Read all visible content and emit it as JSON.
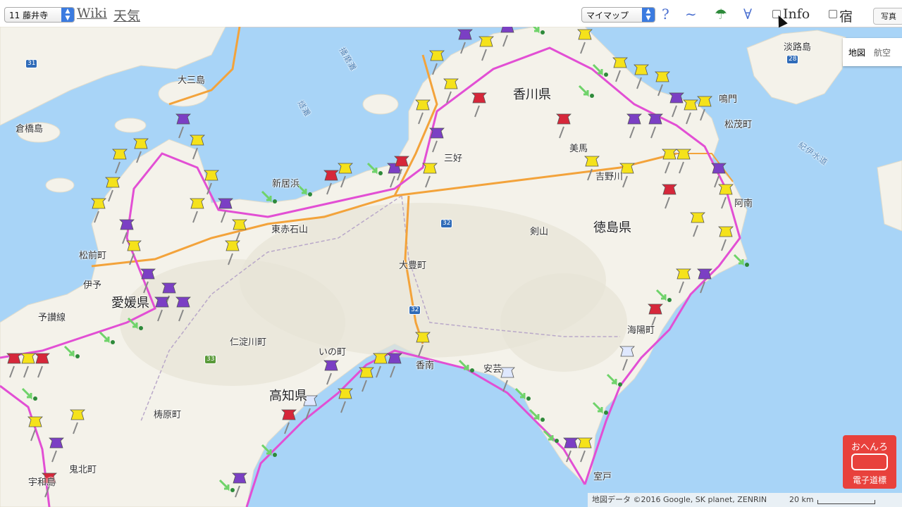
{
  "toolbar": {
    "temple_select": "11 藤井寺",
    "wiki_link": "Wiki",
    "weather_link": "天気",
    "mymap_select": "マイマップ",
    "help_glyph": "?",
    "elevation_glyph": "∼",
    "umbrella_glyph": "☂",
    "filter_glyph": "∀",
    "info_label": "Info",
    "lodging_label": "宿",
    "photo_button": "写真"
  },
  "map": {
    "type_control": {
      "map": "地図",
      "satellite": "航空"
    },
    "attribution": "地図データ ©2016 Google, SK planet, ZENRIN",
    "scale": "20 km",
    "places": [
      {
        "name": "大三島",
        "kind": "place"
      },
      {
        "name": "倉橋島",
        "kind": "place"
      },
      {
        "name": "香川県",
        "kind": "pref"
      },
      {
        "name": "徳島県",
        "kind": "pref"
      },
      {
        "name": "愛媛県",
        "kind": "pref"
      },
      {
        "name": "鳴門",
        "kind": "place"
      },
      {
        "name": "松茂町",
        "kind": "place"
      },
      {
        "name": "淡路島",
        "kind": "place"
      },
      {
        "name": "美馬",
        "kind": "place"
      },
      {
        "name": "吉野川",
        "kind": "place"
      },
      {
        "name": "新居浜",
        "kind": "place"
      },
      {
        "name": "東赤石山",
        "kind": "place"
      },
      {
        "name": "剣山",
        "kind": "place"
      },
      {
        "name": "大豊町",
        "kind": "place"
      },
      {
        "name": "仁淀川町",
        "kind": "place"
      },
      {
        "name": "いの町",
        "kind": "place"
      },
      {
        "name": "香南",
        "kind": "place"
      },
      {
        "name": "安芸",
        "kind": "place"
      },
      {
        "name": "海陽町",
        "kind": "place"
      },
      {
        "name": "高知県",
        "kind": "pref"
      },
      {
        "name": "梼原町",
        "kind": "place"
      },
      {
        "name": "鬼北町",
        "kind": "place"
      },
      {
        "name": "松前町",
        "kind": "place"
      },
      {
        "name": "伊予",
        "kind": "place"
      },
      {
        "name": "予讃線",
        "kind": "place"
      },
      {
        "name": "播磨灘",
        "kind": "sea"
      },
      {
        "name": "紀伊水道",
        "kind": "sea"
      },
      {
        "name": "燧灘",
        "kind": "sea"
      },
      {
        "name": "阿南",
        "kind": "place"
      },
      {
        "name": "室戸",
        "kind": "place"
      },
      {
        "name": "宇和島",
        "kind": "place"
      },
      {
        "name": "三好",
        "kind": "place"
      }
    ],
    "routes": [
      "31",
      "28",
      "32",
      "32",
      "33"
    ],
    "pins": {
      "yellow": "#f5e21b",
      "red": "#d6273a",
      "purple": "#7b3fc4",
      "green_arrow": "#6fd36a",
      "route": "#e24fd4"
    }
  },
  "logo": {
    "line1": "おへんろ",
    "line2": "電子道標"
  }
}
